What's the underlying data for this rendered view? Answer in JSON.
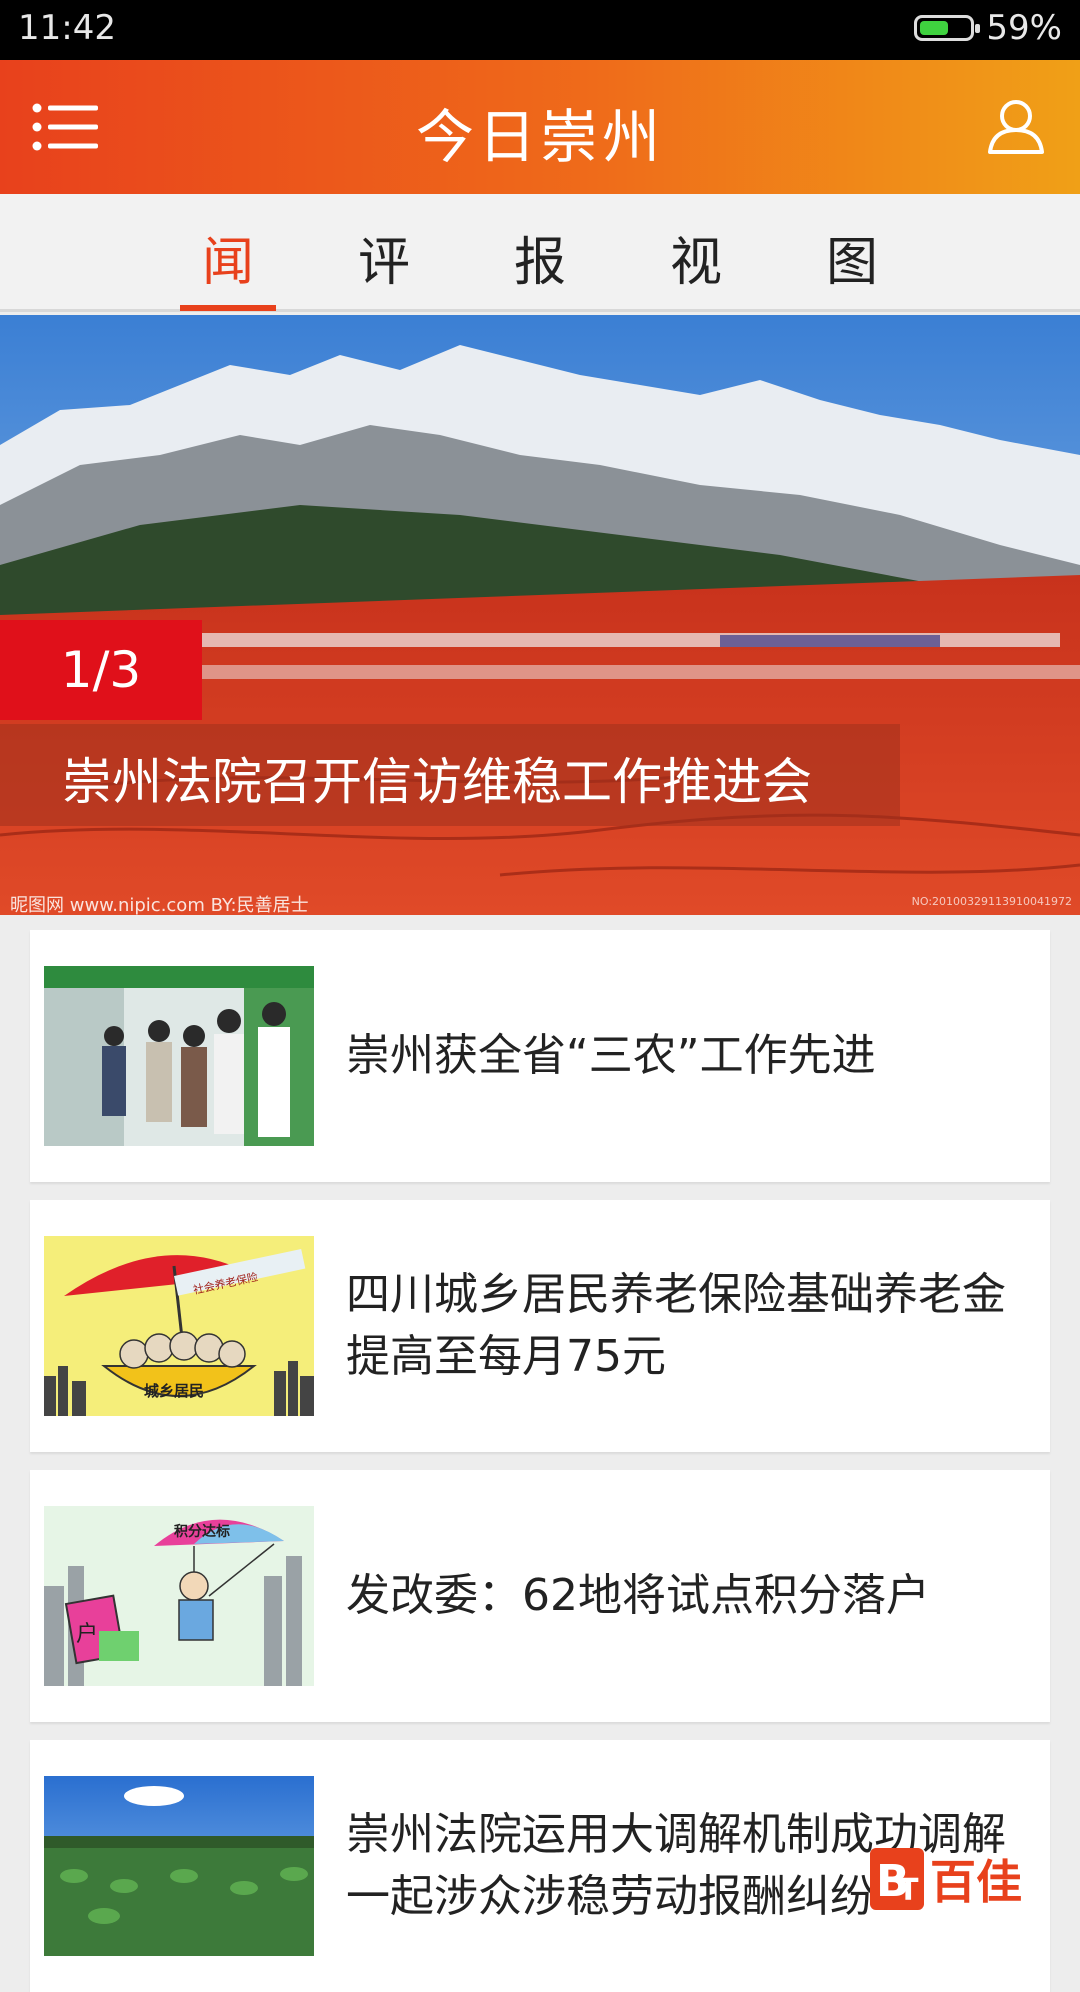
{
  "status_bar": {
    "time": "11:42",
    "battery_percent": "59%",
    "battery_level": 0.59
  },
  "header": {
    "title": "今日崇州",
    "menu_icon": "menu-icon",
    "user_icon": "user-icon"
  },
  "tabs": [
    {
      "label": "闻",
      "active": true
    },
    {
      "label": "评",
      "active": false
    },
    {
      "label": "报",
      "active": false
    },
    {
      "label": "视",
      "active": false
    },
    {
      "label": "图",
      "active": false
    }
  ],
  "hero": {
    "counter": "1/3",
    "title": "崇州法院召开信访维稳工作推进会",
    "watermark": "昵图网 www.nipic.com  BY:民善居士",
    "watermark_id": "NO:20100329113910041972"
  },
  "news": [
    {
      "title": "崇州获全省“三农”工作先进",
      "thumb": "farm-visit-photo"
    },
    {
      "title": "四川城乡居民养老保险基础养老金提高至每月75元",
      "thumb": "pension-cartoon",
      "thumb_text": [
        "社会养老保险",
        "城乡居民"
      ]
    },
    {
      "title": "发改委：62地将试点积分落户",
      "thumb": "hukou-cartoon",
      "thumb_text": [
        "积分达标",
        "户"
      ]
    },
    {
      "title": "崇州法院运用大调解机制成功调解一起涉众涉稳劳动报酬纠纷",
      "thumb": "lotus-lake-photo"
    }
  ],
  "brand": {
    "name": "百佳"
  },
  "colors": {
    "accent": "#e8411c",
    "header_end": "#f0a017",
    "counter_bg": "#e0101a"
  }
}
